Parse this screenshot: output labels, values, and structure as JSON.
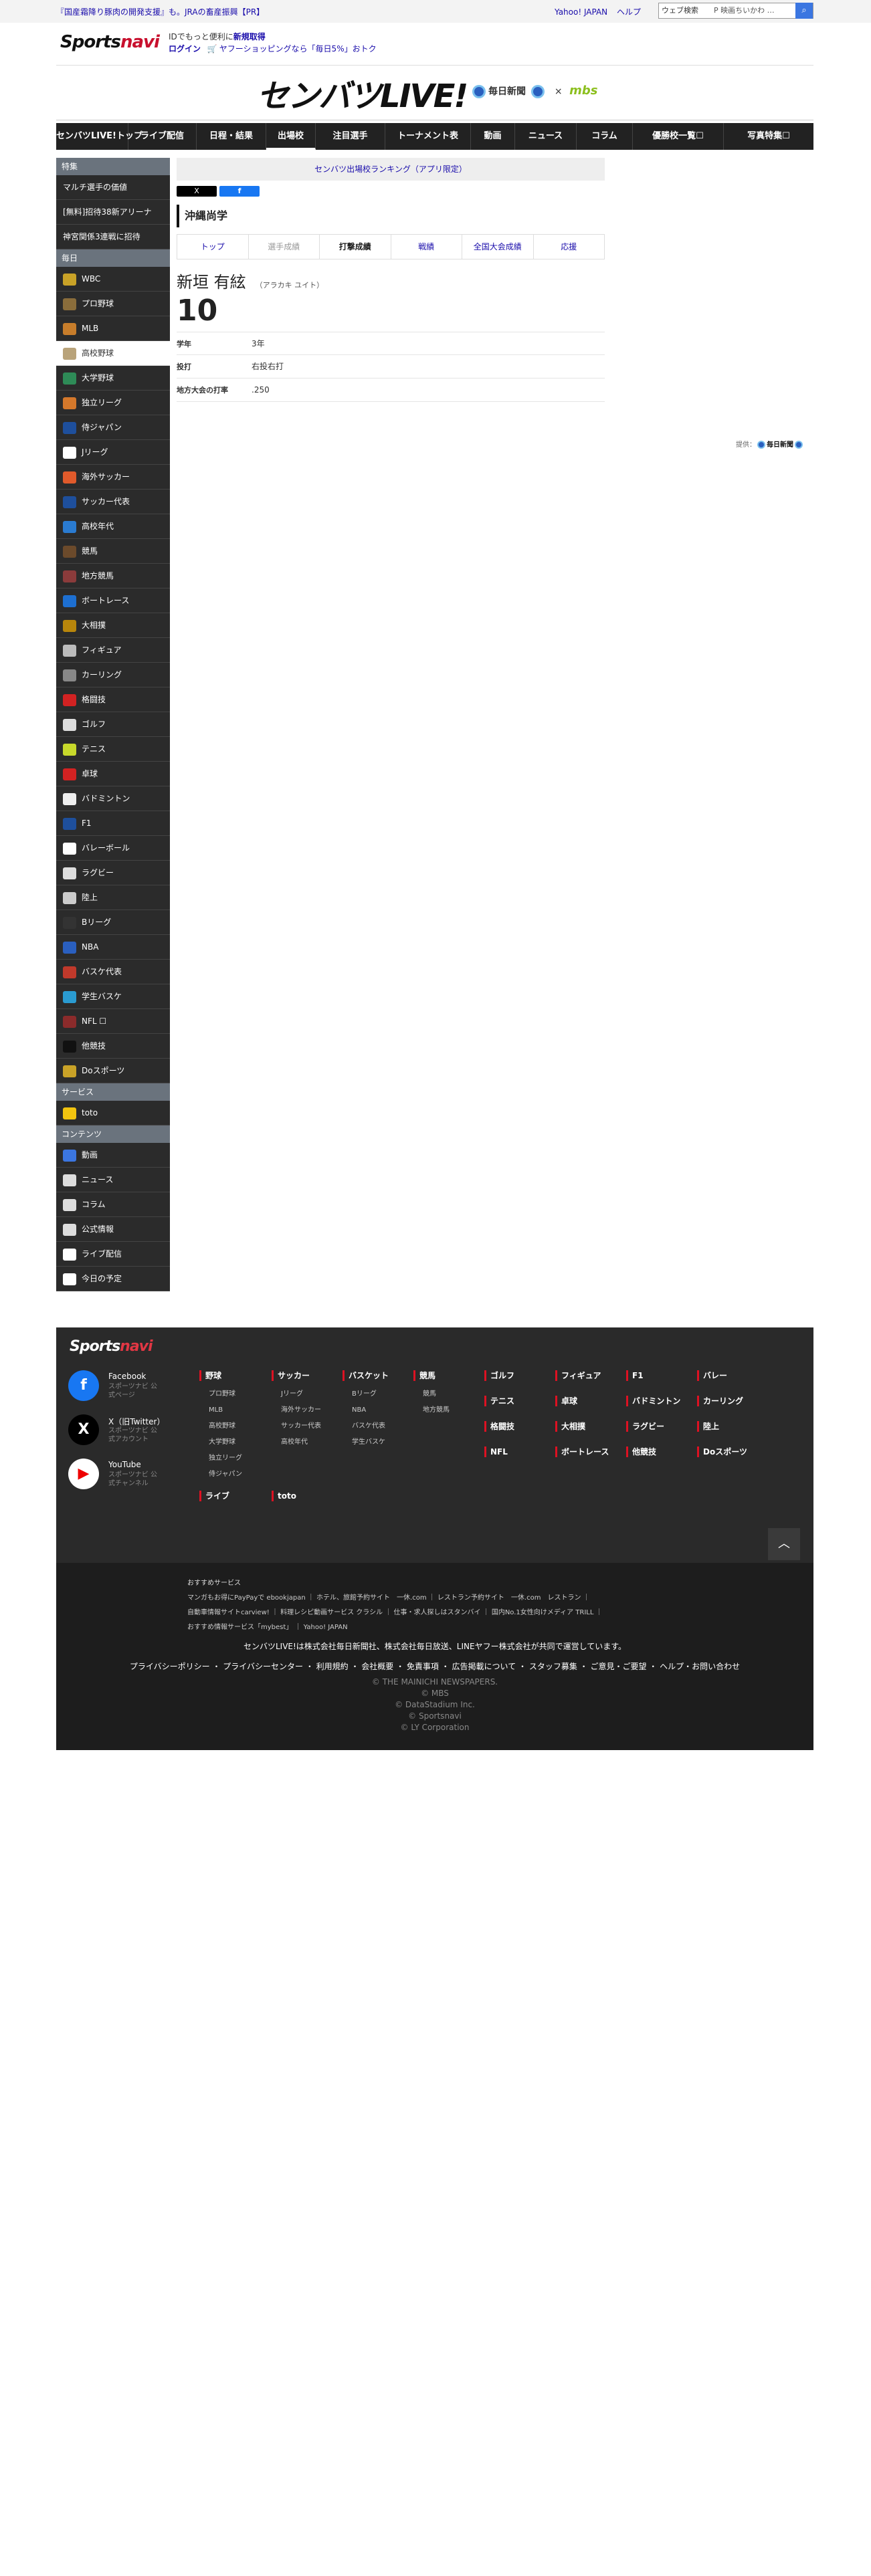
{
  "topbar": {
    "pr_text": "『国産霜降り豚肉の開発支援』も。JRAの畜産振興【PR】",
    "links": [
      "Yahoo! JAPAN",
      "ヘルプ"
    ],
    "search_scope": "ウェブ検索",
    "search_query": "P 映画ちいかわ …",
    "search_icon": "search-icon"
  },
  "header": {
    "logo_main": "Sports",
    "logo_accent": "navi",
    "id_line": "IDでもっと便利に",
    "register_link": "新規取得",
    "login_link": "ログイン",
    "shopping_text": "ヤフーショッピングなら「毎日5%」おトク"
  },
  "brand": {
    "title": "センバツLIVE!",
    "partner1": "毎日新聞",
    "times": "×",
    "partner2": "mbs"
  },
  "nav": {
    "items": [
      "センバツLIVE!トップ",
      "ライブ配信",
      "日程・結果",
      "出場校",
      "注目選手",
      "トーナメント表",
      "動画",
      "ニュース",
      "コラム",
      "優勝校一覧☐",
      "写真特集☐"
    ]
  },
  "sidebar": {
    "special_head": "特集",
    "special_items": [
      "マルチ選手の価値",
      "[無料]招待38新アリーナ",
      "神宮関係3連戦に招待"
    ],
    "daily_head": "毎日",
    "daily_items": [
      {
        "label": "WBC",
        "icon": "baseball-bat-icon",
        "color": "#c9a227"
      },
      {
        "label": "プロ野球",
        "icon": "baseball-bat-icon",
        "color": "#8a6d3b"
      },
      {
        "label": "MLB",
        "icon": "baseball-bat-icon",
        "color": "#c77d2b"
      },
      {
        "label": "高校野球",
        "icon": "baseball-bat-icon",
        "color": "#b9a37a"
      },
      {
        "label": "大学野球",
        "icon": "baseball-bat-icon",
        "color": "#2e8b57"
      },
      {
        "label": "独立リーグ",
        "icon": "baseball-bat-icon",
        "color": "#d4782b"
      },
      {
        "label": "侍ジャパン",
        "icon": "baseball-bat-icon",
        "color": "#1e4f9c"
      },
      {
        "label": "Jリーグ",
        "icon": "soccer-ball-icon",
        "color": "#ffffff"
      },
      {
        "label": "海外サッカー",
        "icon": "soccer-ball-icon",
        "color": "#e05a2b"
      },
      {
        "label": "サッカー代表",
        "icon": "soccer-ball-icon",
        "color": "#1e4f9c"
      },
      {
        "label": "高校年代",
        "icon": "soccer-ball-icon",
        "color": "#2a7bd1"
      },
      {
        "label": "競馬",
        "icon": "horse-icon",
        "color": "#6b4a2b"
      },
      {
        "label": "地方競馬",
        "icon": "horse-icon",
        "color": "#8b3b3b"
      },
      {
        "label": "ボートレース",
        "icon": "boat-icon",
        "color": "#1d6fd1"
      },
      {
        "label": "大相撲",
        "icon": "sumo-icon",
        "color": "#b8860b"
      },
      {
        "label": "フィギュア",
        "icon": "skate-icon",
        "color": "#bbbbbb"
      },
      {
        "label": "カーリング",
        "icon": "curling-stone-icon",
        "color": "#888888"
      },
      {
        "label": "格闘技",
        "icon": "boxing-glove-icon",
        "color": "#d22222"
      },
      {
        "label": "ゴルフ",
        "icon": "golf-icon",
        "color": "#dddddd"
      },
      {
        "label": "テニス",
        "icon": "tennis-ball-icon",
        "color": "#c8d92b"
      },
      {
        "label": "卓球",
        "icon": "ping-pong-icon",
        "color": "#d22222"
      },
      {
        "label": "バドミントン",
        "icon": "shuttlecock-icon",
        "color": "#eeeeee"
      },
      {
        "label": "F1",
        "icon": "f1-car-icon",
        "color": "#1e4f9c"
      },
      {
        "label": "バレーボール",
        "icon": "volleyball-icon",
        "color": "#ffffff"
      },
      {
        "label": "ラグビー",
        "icon": "rugby-ball-icon",
        "color": "#dddddd"
      },
      {
        "label": "陸上",
        "icon": "running-shoe-icon",
        "color": "#cccccc"
      },
      {
        "label": "Bリーグ",
        "icon": "basketball-icon",
        "color": "#333333"
      },
      {
        "label": "NBA",
        "icon": "basketball-icon",
        "color": "#2a5fbf"
      },
      {
        "label": "バスケ代表",
        "icon": "basketball-icon",
        "color": "#c0392b"
      },
      {
        "label": "学生バスケ",
        "icon": "basketball-icon",
        "color": "#2a9bd1"
      },
      {
        "label": "NFL ☐",
        "icon": "football-icon",
        "color": "#8b2b2b"
      },
      {
        "label": "他競技",
        "icon": "medal-icon",
        "color": "#111111"
      },
      {
        "label": "Doスポーツ",
        "icon": "do-sports-icon",
        "color": "#c9a227"
      }
    ],
    "service_head": "サービス",
    "service_items": [
      {
        "label": "toto",
        "icon": "toto-icon",
        "color": "#f2c40f"
      }
    ],
    "content_head": "コンテンツ",
    "content_items": [
      {
        "label": "動画",
        "icon": "play-icon",
        "color": "#3b76e1"
      },
      {
        "label": "ニュース",
        "icon": "newspaper-icon",
        "color": "#dddddd"
      },
      {
        "label": "コラム",
        "icon": "column-icon",
        "color": "#dddddd"
      },
      {
        "label": "公式情報",
        "icon": "info-doc-icon",
        "color": "#dddddd"
      },
      {
        "label": "ライブ配信",
        "icon": "live-icon",
        "color": "#ffffff"
      },
      {
        "label": "今日の予定",
        "icon": "calendar-icon",
        "color": "#ffffff"
      }
    ]
  },
  "main": {
    "ranking_link": "センバツ出場校ランキング（アプリ限定）",
    "share_x": "X",
    "share_fb": "f",
    "school_name": "沖縄尚学",
    "tabs": [
      {
        "label": "トップ",
        "state": "link"
      },
      {
        "label": "選手成績",
        "state": "disabled"
      },
      {
        "label": "打撃成績",
        "state": "active"
      },
      {
        "label": "戦績",
        "state": "link"
      },
      {
        "label": "全国大会成績",
        "state": "link"
      },
      {
        "label": "応援",
        "state": "link"
      }
    ],
    "player_name": "新垣 有絃",
    "player_kana": "（アラカキ ユイト）",
    "player_number": "10",
    "info": [
      {
        "key": "学年",
        "value": "3年"
      },
      {
        "key": "投打",
        "value": "右投右打"
      },
      {
        "key": "地方大会の打率",
        "value": ".250"
      }
    ],
    "credit_label": "提供：",
    "credit_name": "毎日新聞"
  },
  "footer": {
    "logo_main": "Sports",
    "logo_accent": "navi",
    "social": [
      {
        "title": "Facebook",
        "desc": "スポーツナビ 公式ページ",
        "glyph": "f",
        "bg": "#1877f2",
        "icon": "facebook-icon"
      },
      {
        "title": "X（旧Twitter）",
        "desc": "スポーツナビ 公式アカウント",
        "glyph": "X",
        "bg": "#000000",
        "icon": "x-icon"
      },
      {
        "title": "YouTube",
        "desc": "スポーツナビ 公式チャンネル",
        "glyph": "▶",
        "bg": "#ffffff",
        "icon": "youtube-icon"
      }
    ],
    "columns": [
      {
        "head": "野球",
        "subs": [
          "プロ野球",
          "MLB",
          "高校野球",
          "大学野球",
          "独立リーグ",
          "侍ジャパン"
        ]
      },
      {
        "head": "サッカー",
        "subs": [
          "Jリーグ",
          "海外サッカー",
          "サッカー代表",
          "高校年代"
        ]
      },
      {
        "head": "バスケット",
        "subs": [
          "Bリーグ",
          "NBA",
          "バスケ代表",
          "学生バスケ"
        ]
      },
      {
        "head": "競馬",
        "subs": [
          "競馬",
          "地方競馬"
        ]
      }
    ],
    "extra_heads": [
      "ライブ",
      "toto"
    ],
    "grid_col1": [
      "ゴルフ",
      "テニス",
      "格闘技",
      "NFL"
    ],
    "grid_col2": [
      "フィギュア",
      "卓球",
      "大相撲",
      "ボートレース"
    ],
    "grid_col3": [
      "F1",
      "バドミントン",
      "ラグビー",
      "他競技"
    ],
    "grid_col4": [
      "バレー",
      "カーリング",
      "陸上",
      "Doスポーツ"
    ],
    "pagetop": "︿",
    "rec_title": "おすすめサービス",
    "rec_line1": "マンガもお得にPayPayで ebookjapan ｜ ホテル、旅館予約サイト　一休.com ｜ レストラン予約サイト　一休.com　レストラン ｜",
    "rec_line2": "自動車情報サイトcarview! ｜ 料理レシピ動画サービス クラシル ｜ 仕事・求人探しはスタンバイ ｜ 国内No.1女性向けメディア TRILL ｜",
    "rec_line3": "おすすめ情報サービス「mybest」 ｜ Yahoo! JAPAN",
    "operated": "センバツLIVE!は株式会社毎日新聞社、株式会社毎日放送、LINEヤフー株式会社が共同で運営しています。",
    "links": "プライバシーポリシー ・ プライバシーセンター ・ 利用規約 ・ 会社概要 ・ 免責事項 ・ 広告掲載について ・ スタッフ募集 ・ ご意見・ご要望 ・ ヘルプ・お問い合わせ",
    "copyright": [
      "© THE MAINICHI NEWSPAPERS.",
      "© MBS",
      "© DataStadium Inc.",
      "© Sportsnavi",
      "© LY Corporation"
    ]
  }
}
